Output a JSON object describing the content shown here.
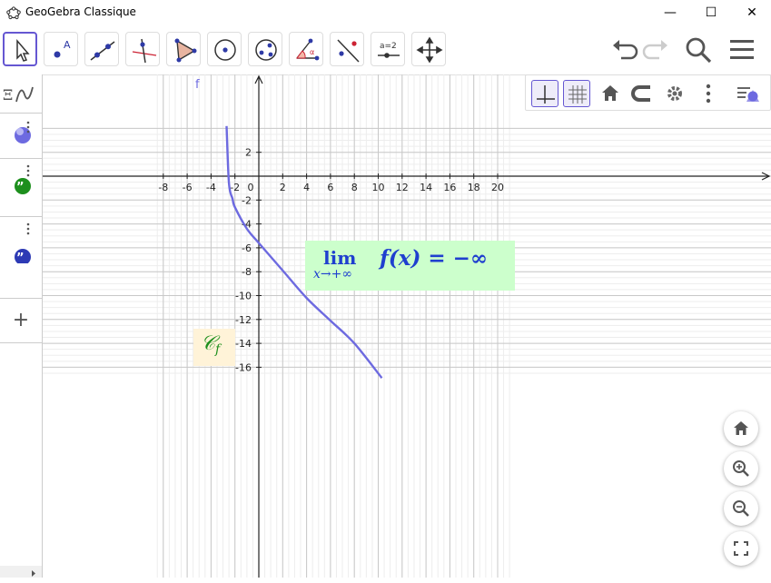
{
  "window": {
    "title": "GeoGebra Classique",
    "minimize": "—",
    "maximize": "☐",
    "close": "✕"
  },
  "toolbar": {
    "tools": [
      {
        "name": "move-tool",
        "icon": "cursor-arrow-icon",
        "active": true
      },
      {
        "name": "point-tool",
        "icon": "point-a-icon"
      },
      {
        "name": "line-tool",
        "icon": "line-through-points-icon"
      },
      {
        "name": "perpendicular-tool",
        "icon": "perpendicular-line-icon"
      },
      {
        "name": "polygon-tool",
        "icon": "polygon-icon"
      },
      {
        "name": "circle-tool",
        "icon": "circle-center-point-icon"
      },
      {
        "name": "conic-tool",
        "icon": "ellipse-icon"
      },
      {
        "name": "angle-tool",
        "icon": "angle-icon"
      },
      {
        "name": "reflect-tool",
        "icon": "reflect-icon"
      },
      {
        "name": "slider-tool",
        "icon": "slider-icon",
        "label": "a=2"
      },
      {
        "name": "move-graphics-tool",
        "icon": "move-arrows-icon"
      }
    ],
    "right": [
      "undo-icon",
      "redo-icon",
      "search-icon",
      "menu-icon"
    ]
  },
  "stylebar": {
    "buttons": [
      "axes-icon",
      "grid-icon",
      "home-icon",
      "point-capture-icon",
      "settings-icon",
      "more-vertical-icon"
    ]
  },
  "graphics": {
    "function_label": "f",
    "x_ticks": [
      "-8",
      "-6",
      "-4",
      "-2",
      "0",
      "2",
      "4",
      "6",
      "8",
      "10",
      "12",
      "14",
      "16",
      "18",
      "20"
    ],
    "y_ticks": [
      "2",
      "-2",
      "-4",
      "-6",
      "-8",
      "-10",
      "-12",
      "-14",
      "-16"
    ],
    "limit_text": {
      "lim": "lim",
      "sub": "x→+∞",
      "expr": "f(x) = −∞"
    },
    "curve_label": {
      "main": "𝒞",
      "sub": "f"
    },
    "curve_color": "#6d6ae0",
    "limit_bg": "#ccffcc",
    "curve_label_bg": "#fff3d8",
    "curve_label_color": "#1d8f1d",
    "limit_color": "#1f3fcf"
  },
  "chart_data": {
    "type": "line",
    "title": "",
    "xlabel": "",
    "ylabel": "",
    "xlim": [
      -8.8,
      21.3
    ],
    "ylim": [
      -16.9,
      4.2
    ],
    "grid": true,
    "series": [
      {
        "name": "f",
        "x": [
          -2.7,
          -2.5,
          -2.2,
          -2.0,
          -1.0,
          0,
          2,
          4,
          6,
          8,
          10.3
        ],
        "y": [
          4.2,
          -0.6,
          -1.9,
          -2.6,
          -4.4,
          -5.6,
          -7.9,
          -10.2,
          -12.1,
          -14.0,
          -16.9
        ]
      }
    ]
  },
  "zoom": {
    "buttons": [
      "home-icon",
      "zoom-in-icon",
      "zoom-out-icon",
      "fullscreen-icon"
    ]
  },
  "algebra": {
    "items": [
      "algebra-view-icon",
      "point-object-icon",
      "text-object-green-icon",
      "text-object-blue-icon"
    ],
    "add": "+"
  }
}
